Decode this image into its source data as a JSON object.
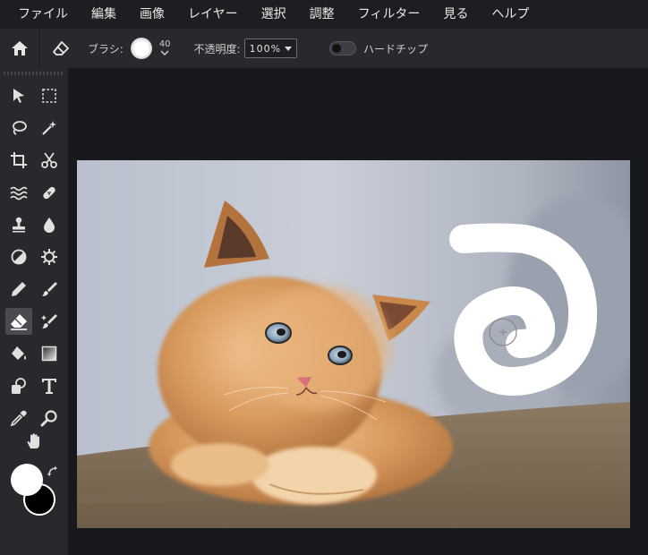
{
  "menu": [
    "ファイル",
    "編集",
    "画像",
    "レイヤー",
    "選択",
    "調整",
    "フィルター",
    "見る",
    "ヘルプ"
  ],
  "options": {
    "brush_label": "ブラシ:",
    "brush_size": "40",
    "opacity_label": "不透明度:",
    "opacity_value": "100%",
    "hard_tip_label": "ハードチップ",
    "hard_tip_on": false
  },
  "tools": {
    "active": "eraser-tool"
  },
  "colors": {
    "foreground": "#ffffff",
    "background": "#000000"
  }
}
